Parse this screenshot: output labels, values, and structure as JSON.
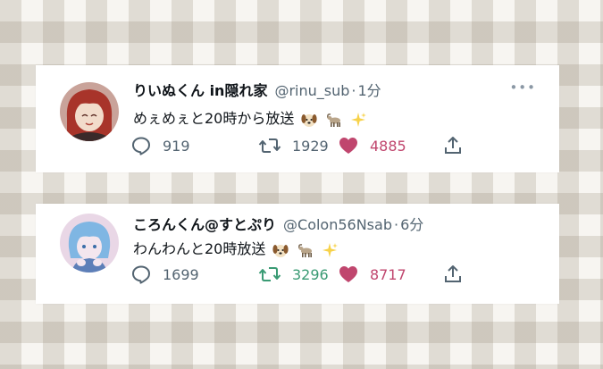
{
  "tweets": [
    {
      "name": "りいぬくん in隠れ家",
      "handle": "@rinu_sub",
      "separator": "·",
      "time": "1分",
      "text": "めぇめぇと20時から放送",
      "emojis": [
        "dog-face-emoji",
        "goat-emoji",
        "sparkles-emoji"
      ],
      "replies": "919",
      "retweets": "1929",
      "likes": "4885",
      "more": "•••",
      "retweeted": false,
      "avatar_colors": {
        "hair": "#a8342a",
        "skin": "#f2dccb",
        "bg": "#c9a39a"
      }
    },
    {
      "name": "ころんくん@すとぷり",
      "handle": "@Colon56Nsab",
      "separator": "·",
      "time": "6分",
      "text": "わんわんと20時放送",
      "emojis": [
        "dog-face-emoji",
        "goat-emoji",
        "sparkles-emoji"
      ],
      "replies": "1699",
      "retweets": "3296",
      "likes": "8717",
      "more": "•••",
      "retweeted": true,
      "avatar_colors": {
        "hair": "#7fb6e3",
        "skin": "#f4e6ee",
        "bg": "#e9d7e6"
      }
    }
  ],
  "colors": {
    "text": "#0f1419",
    "secondary": "#536471",
    "like": "#c0466e",
    "retweet_active": "#3a9b74",
    "background_check": "#d8d2c6"
  }
}
